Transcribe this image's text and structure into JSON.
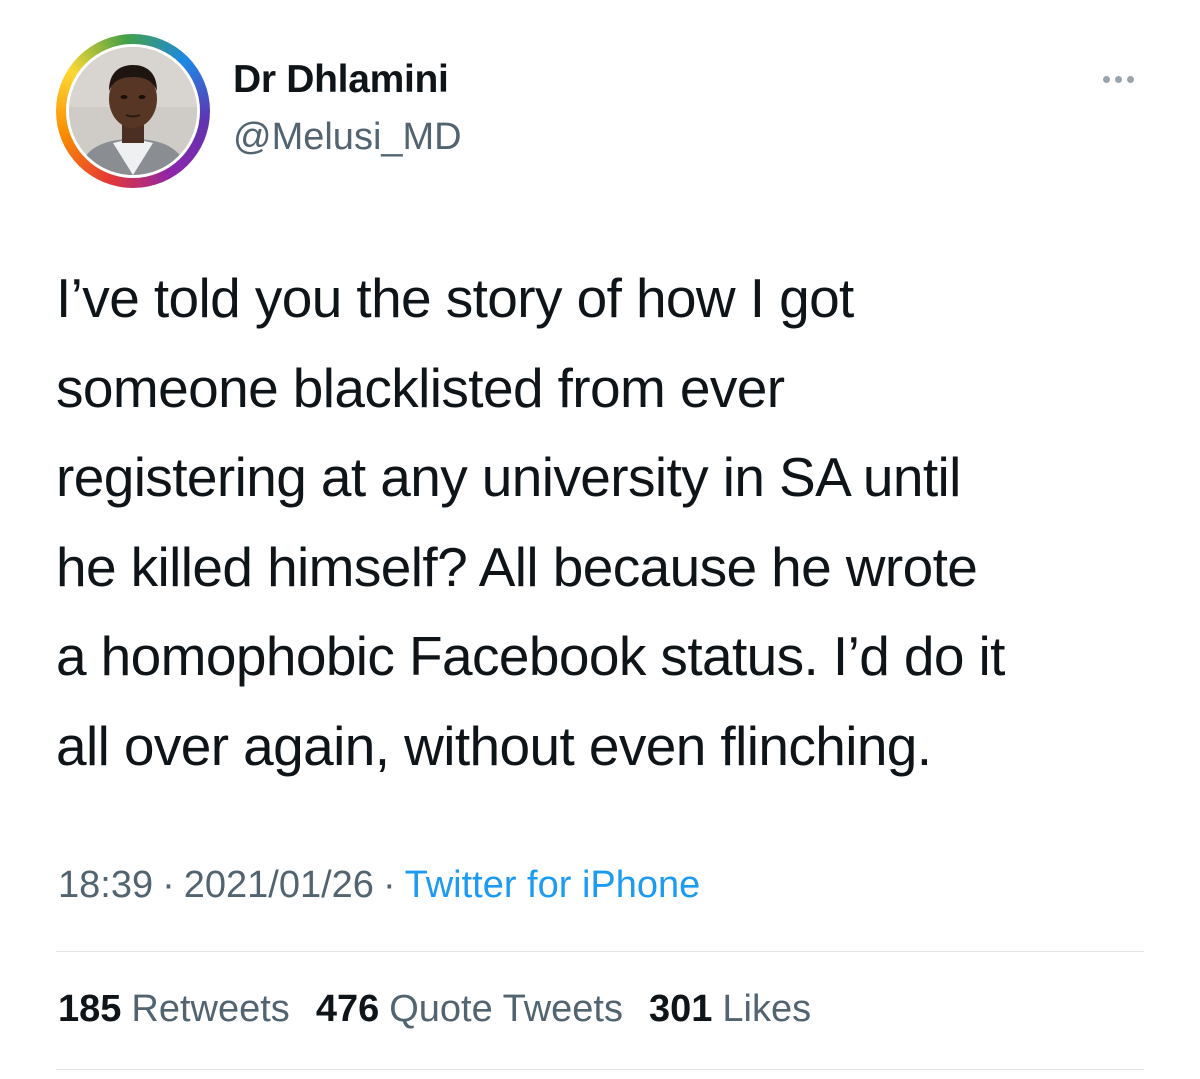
{
  "author": {
    "display_name": "Dr Dhlamini",
    "handle": "@Melusi_MD"
  },
  "tweet": {
    "lines": [
      "I’ve told you the story of how I got",
      "someone blacklisted from ever",
      "registering at any university in SA until",
      "he killed himself? All because he wrote",
      "a homophobic Facebook status. I’d do it",
      "all over again, without even flinching."
    ]
  },
  "meta": {
    "time": "18:39",
    "separator": "·",
    "date": "2021/01/26",
    "source": "Twitter for iPhone"
  },
  "stats": {
    "retweets": {
      "count": "185",
      "label": "Retweets"
    },
    "quote_tweets": {
      "count": "476",
      "label": "Quote Tweets"
    },
    "likes": {
      "count": "301",
      "label": "Likes"
    }
  },
  "icons": {
    "more": "more-horizontal-icon"
  },
  "colors": {
    "text": "#0f1419",
    "secondary": "#536471",
    "link": "#1d9bf0",
    "divider": "#e1e5e8"
  }
}
